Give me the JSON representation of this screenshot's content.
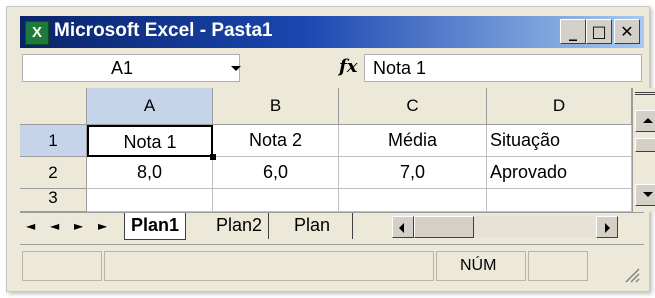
{
  "window": {
    "title": "Microsoft Excel - Pasta1",
    "app_icon_glyph": "X",
    "minimize_glyph": "_",
    "maximize_glyph": "□",
    "close_glyph": "✕"
  },
  "formula_bar": {
    "name_box": "A1",
    "fx_label": "fx",
    "formula_value": "Nota 1"
  },
  "sheet": {
    "columns": [
      "A",
      "B",
      "C",
      "D"
    ],
    "rows": [
      {
        "header": "1",
        "cells": [
          "Nota 1",
          "Nota 2",
          "Média",
          "Situação"
        ]
      },
      {
        "header": "2",
        "cells": [
          "8,0",
          "6,0",
          "7,0",
          "Aprovado"
        ]
      }
    ],
    "partial_row_header": "3",
    "active_cell": "A1"
  },
  "tabs": {
    "nav_first": "◄",
    "nav_prev": "◄",
    "nav_next": "►",
    "nav_last": "►",
    "sheets": [
      "Plan1",
      "Plan2",
      "Plan"
    ],
    "active": "Plan1"
  },
  "status_bar": {
    "num_indicator": "NÚM"
  },
  "colors": {
    "title_start": "#0a246a",
    "title_end": "#a6caf0",
    "selected_header": "#c6d4ea",
    "chrome": "#ece9d8"
  }
}
